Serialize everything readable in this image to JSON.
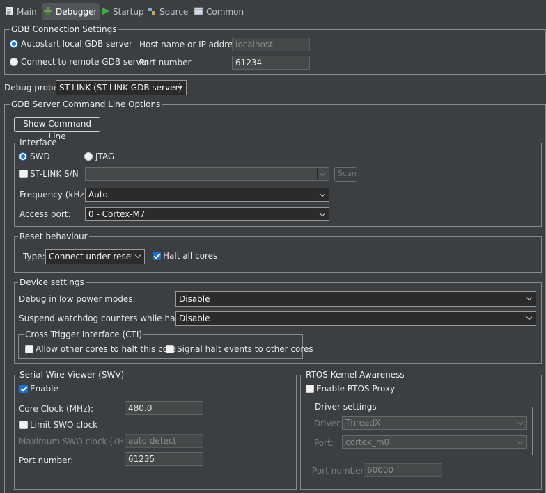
{
  "tabs": [
    {
      "label": "Main",
      "icon": "document-icon",
      "active": false
    },
    {
      "label": "Debugger",
      "icon": "bug-icon",
      "active": true
    },
    {
      "label": "Startup",
      "icon": "play-icon",
      "active": false
    },
    {
      "label": "Source",
      "icon": "source-icon",
      "active": false
    },
    {
      "label": "Common",
      "icon": "common-icon",
      "active": false
    }
  ],
  "gdb_connection": {
    "title": "GDB Connection Settings",
    "autostart_label": "Autostart local GDB server",
    "remote_label": "Connect to remote GDB server",
    "selected": "autostart",
    "host_label": "Host name or IP address",
    "host_value": "localhost",
    "port_label": "Port number",
    "port_value": "61234"
  },
  "debug_probe": {
    "label": "Debug probe",
    "value": "ST-LINK (ST-LINK GDB server)"
  },
  "gdb_server": {
    "title": "GDB Server Command Line Options",
    "show_cmd_label": "Show Command Line"
  },
  "interface": {
    "title": "Interface",
    "swd_label": "SWD",
    "jtag_label": "JTAG",
    "selected": "SWD",
    "stlink_sn_label": "ST-LINK S/N",
    "stlink_sn_value": "",
    "scan_label": "Scan",
    "frequency_label": "Frequency (kHz):",
    "frequency_value": "Auto",
    "access_port_label": "Access port:",
    "access_port_value": "0 - Cortex-M7"
  },
  "reset": {
    "title": "Reset behaviour",
    "type_label": "Type:",
    "type_value": "Connect under reset",
    "halt_all_label": "Halt all cores",
    "halt_all_checked": true
  },
  "device": {
    "title": "Device settings",
    "low_power_label": "Debug in low power modes:",
    "low_power_value": "Disable",
    "watchdog_label": "Suspend watchdog counters while halted:",
    "watchdog_value": "Disable",
    "cti_title": "Cross Trigger Interface (CTI)",
    "allow_halt_label": "Allow other cores to halt this core",
    "signal_halt_label": "Signal halt events to other cores"
  },
  "swv": {
    "title": "Serial Wire Viewer (SWV)",
    "enable_label": "Enable",
    "enable_checked": true,
    "core_clock_label": "Core Clock (MHz):",
    "core_clock_value": "480.0",
    "limit_swo_label": "Limit SWO clock",
    "max_swo_label": "Maximum SWO clock (kHz):",
    "max_swo_value": "auto detect",
    "port_label": "Port number:",
    "port_value": "61235"
  },
  "rtos": {
    "title": "RTOS Kernel Awareness",
    "enable_proxy_label": "Enable RTOS Proxy",
    "driver_settings_title": "Driver settings",
    "driver_label": "Driver:",
    "driver_value": "ThreadX",
    "port_label": "Port:",
    "port_value": "cortex_m0",
    "port_number_label": "Port number:",
    "port_number_value": "60000"
  },
  "colors": {
    "background": "#3c3f41",
    "accent": "#1a73e8",
    "field_background": "#2b2b2b"
  }
}
